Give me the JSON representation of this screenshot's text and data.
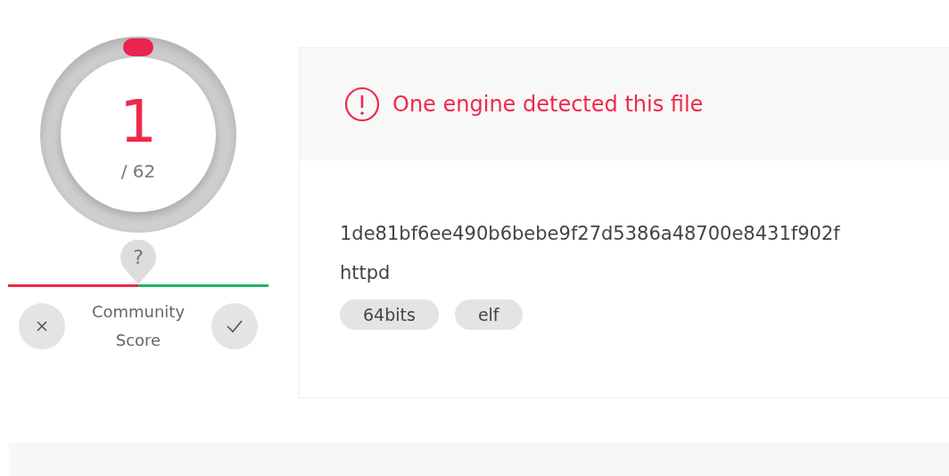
{
  "detection": {
    "count": "1",
    "total": "/ 62"
  },
  "community_score": {
    "marker": "?",
    "label": "Community Score",
    "level": 0.5
  },
  "alert": {
    "message": "One engine detected this file"
  },
  "file": {
    "hash": "1de81bf6ee490b6bebe9f27d5386a48700e8431f902f",
    "name": "httpd",
    "tags": [
      "64bits",
      "elf"
    ]
  }
}
